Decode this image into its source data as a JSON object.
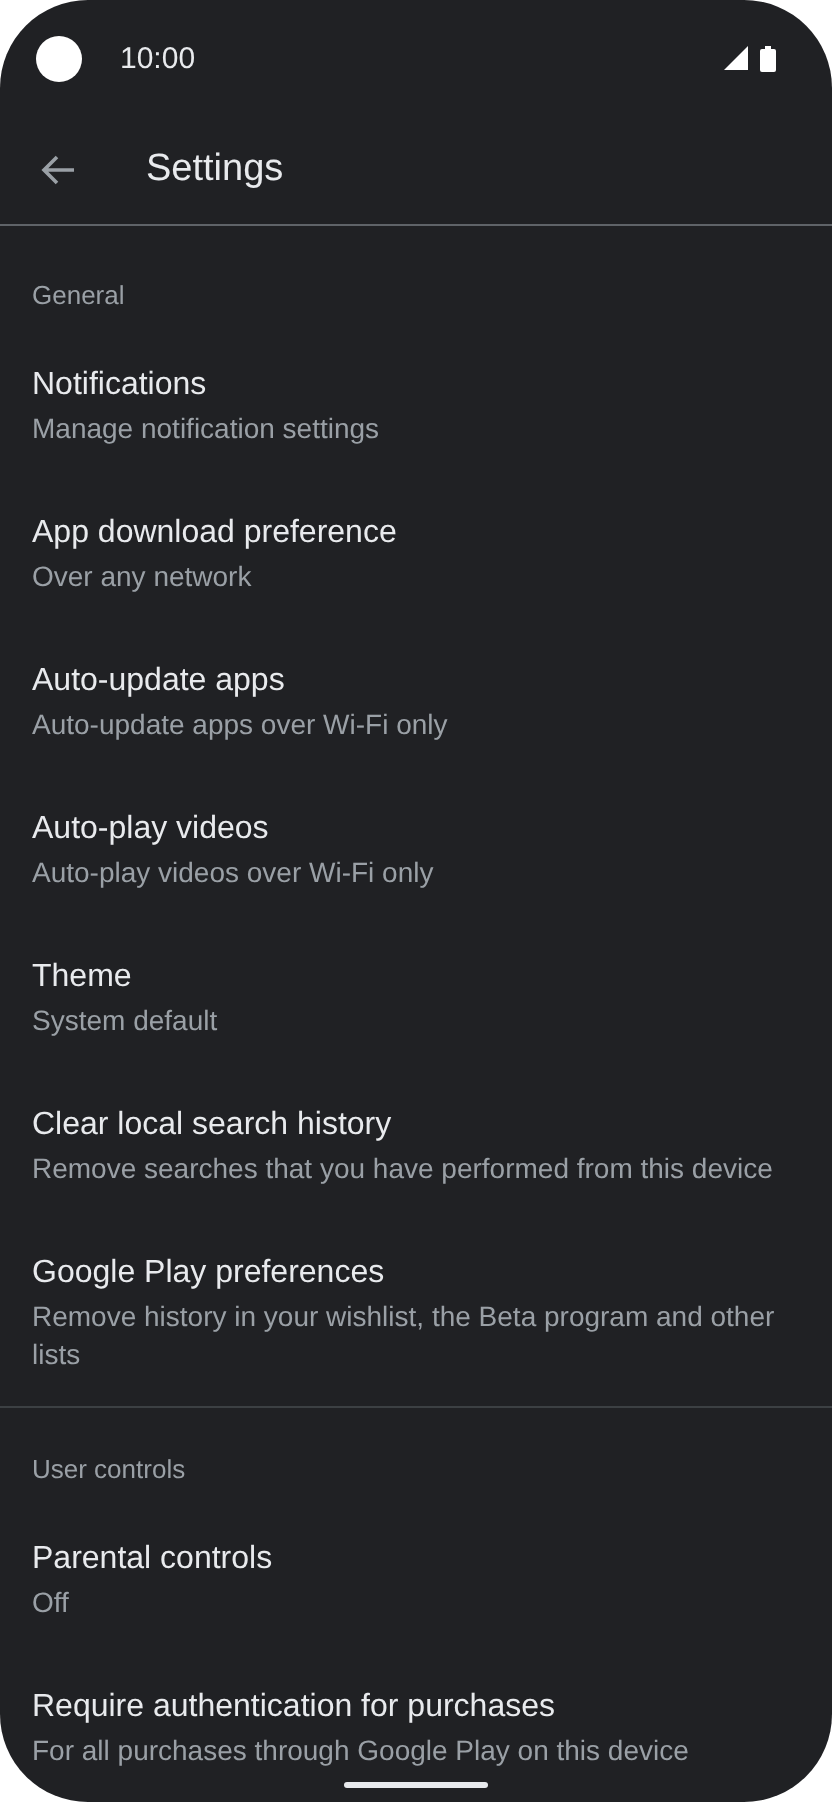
{
  "status_bar": {
    "time": "10:00"
  },
  "toolbar": {
    "title": "Settings"
  },
  "sections": [
    {
      "header": "General",
      "items": [
        {
          "title": "Notifications",
          "subtitle": "Manage notification settings"
        },
        {
          "title": "App download preference",
          "subtitle": "Over any network"
        },
        {
          "title": "Auto-update apps",
          "subtitle": "Auto-update apps over Wi-Fi only"
        },
        {
          "title": "Auto-play videos",
          "subtitle": "Auto-play videos over Wi-Fi only"
        },
        {
          "title": "Theme",
          "subtitle": "System default"
        },
        {
          "title": "Clear local search history",
          "subtitle": "Remove searches that you have performed from this device"
        },
        {
          "title": "Google Play preferences",
          "subtitle": "Remove history in your wishlist, the Beta program and other lists"
        }
      ]
    },
    {
      "header": "User controls",
      "items": [
        {
          "title": "Parental controls",
          "subtitle": "Off"
        },
        {
          "title": "Require authentication for purchases",
          "subtitle": "For all purchases through Google Play on this device"
        }
      ]
    }
  ]
}
